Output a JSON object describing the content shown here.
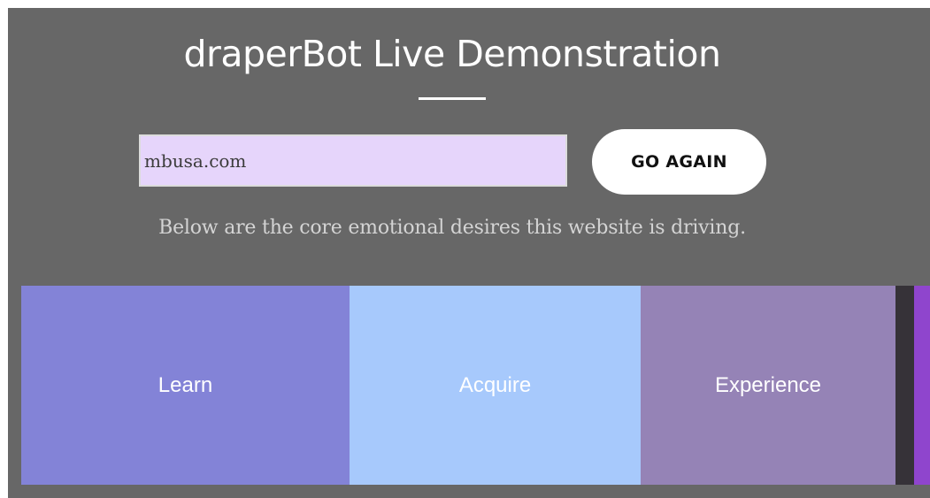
{
  "header": {
    "title": "draperBot Live Demonstration"
  },
  "form": {
    "url_value": "mbusa.com",
    "submit_label": "GO AGAIN"
  },
  "subtitle": "Below are the core emotional desires this website is driving.",
  "chart_data": {
    "type": "treemap",
    "categories": [
      "Learn",
      "Acquire",
      "Experience",
      "",
      ""
    ],
    "values": [
      36.1,
      32.0,
      28.0,
      2.0,
      1.9
    ],
    "colors": [
      "#8383d7",
      "#a7c9fc",
      "#9583b6",
      "#363238",
      "#8f45cd"
    ]
  }
}
